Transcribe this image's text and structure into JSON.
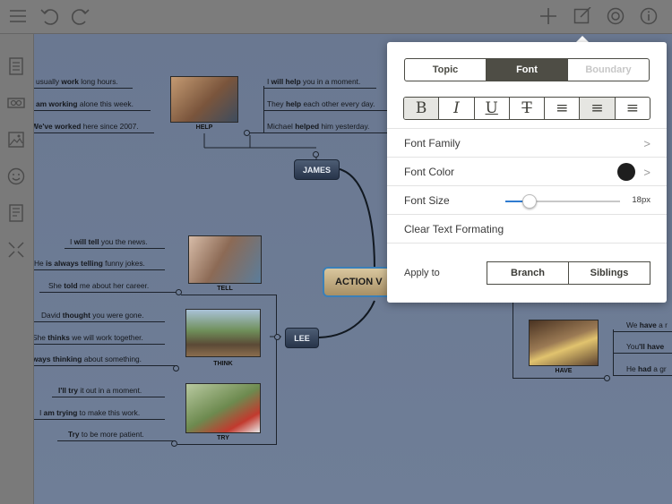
{
  "app": {
    "central_topic": "ACTION V"
  },
  "toolbar": {
    "left": [
      "menu-icon",
      "undo-icon",
      "redo-icon"
    ],
    "right": [
      "add-icon",
      "format-icon",
      "theme-icon",
      "info-icon"
    ]
  },
  "sidebar": {
    "items": [
      "outline-icon",
      "relationship-icon",
      "image-icon",
      "sticker-icon",
      "notes-icon",
      "collapse-icon"
    ]
  },
  "map": {
    "nodes": {
      "james": "JAMES",
      "lee": "LEE"
    },
    "help": {
      "caption": "HELP",
      "left": [
        {
          "pre": "usually ",
          "bold": "work",
          "post": " long hours."
        },
        {
          "pre": "",
          "bold": "am working",
          "post": " alone this week."
        },
        {
          "pre": "",
          "bold": "We've worked",
          "post": " here since 2007."
        }
      ],
      "right": [
        {
          "pre": "I ",
          "bold": "will help",
          "post": " you in a moment."
        },
        {
          "pre": "They ",
          "bold": "help",
          "post": " each other every day."
        },
        {
          "pre": "Michael ",
          "bold": "helped",
          "post": " him yesterday."
        }
      ]
    },
    "tell": {
      "caption": "TELL",
      "lines": [
        {
          "pre": "I ",
          "bold": "will tell",
          "post": " you the news."
        },
        {
          "pre": "He ",
          "bold": "is always telling",
          "post": " funny jokes."
        },
        {
          "pre": "She ",
          "bold": "told",
          "post": " me about her career."
        }
      ]
    },
    "think": {
      "caption": "THINK",
      "lines": [
        {
          "pre": "David ",
          "bold": "thought",
          "post": " you were gone."
        },
        {
          "pre": "She ",
          "bold": "thinks",
          "post": " we will work together."
        },
        {
          "pre": "",
          "bold": "ways thinking",
          "post": " about something."
        }
      ]
    },
    "try": {
      "caption": "TRY",
      "lines": [
        {
          "pre": "",
          "bold": "I'll try",
          "post": " it out in a moment."
        },
        {
          "pre": "I ",
          "bold": "am trying",
          "post": " to make this work."
        },
        {
          "pre": "",
          "bold": "Try",
          "post": " to be more patient."
        }
      ]
    },
    "have": {
      "caption": "HAVE",
      "lines": [
        {
          "pre": "We ",
          "bold": "have",
          "post": " a r"
        },
        {
          "pre": "You",
          "bold": "'ll have",
          "post": ""
        },
        {
          "pre": "He ",
          "bold": "had",
          "post": " a gr"
        }
      ]
    }
  },
  "format_panel": {
    "tabs": [
      {
        "label": "Topic",
        "state": "normal"
      },
      {
        "label": "Font",
        "state": "active"
      },
      {
        "label": "Boundary",
        "state": "disabled"
      }
    ],
    "format_buttons": [
      {
        "glyph": "B",
        "name": "bold-button",
        "on": true
      },
      {
        "glyph": "I",
        "name": "italic-button",
        "on": false
      },
      {
        "glyph": "U",
        "name": "underline-button",
        "on": false
      },
      {
        "glyph": "T",
        "name": "strikethrough-button",
        "on": false
      },
      {
        "glyph": "≡",
        "name": "align-left-button",
        "on": false
      },
      {
        "glyph": "≡",
        "name": "align-center-button",
        "on": true
      },
      {
        "glyph": "≡",
        "name": "align-right-button",
        "on": false
      }
    ],
    "font_family_label": "Font Family",
    "font_color_label": "Font Color",
    "font_color_value": "#1e1e1e",
    "font_size_label": "Font Size",
    "font_size_value": "18px",
    "font_size_slider_fraction": 0.2,
    "clear_label": "Clear Text Formating",
    "apply_label": "Apply to",
    "apply_buttons": [
      "Branch",
      "Siblings"
    ]
  }
}
